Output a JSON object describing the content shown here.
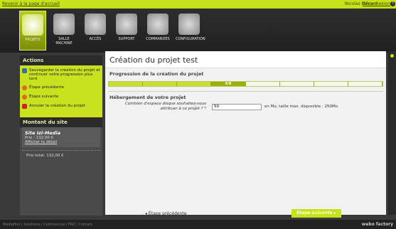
{
  "topbar": {
    "back_link": "Revenir à la page d'accueil",
    "user": "Nicolas Ménard",
    "logout": "Déconnexion",
    "help": "?"
  },
  "nav": [
    {
      "label": "PROJETS",
      "icon": "projects-icon"
    },
    {
      "label": "SALLE MACHINE",
      "icon": "server-icon"
    },
    {
      "label": "ACCÈS",
      "icon": "access-icon"
    },
    {
      "label": "SUPPORT",
      "icon": "support-icon"
    },
    {
      "label": "COMMANDES",
      "icon": "orders-icon"
    },
    {
      "label": "CONFIGURATION",
      "icon": "gear-icon"
    }
  ],
  "sidebar": {
    "actions_title": "Actions",
    "actions": [
      {
        "label": "Sauvegarder la création du projet et continuer votre progression plus tard",
        "icon": "save-icon"
      },
      {
        "label": "Étape précédente",
        "icon": "arrow-left-icon"
      },
      {
        "label": "Étape suivante",
        "icon": "arrow-right-icon"
      },
      {
        "label": "Annuler la création du projet",
        "icon": "warning-icon"
      }
    ],
    "amount_title": "Montant du site",
    "site_name": "Site Izi-Media",
    "site_price": "Prix : 132,00 €",
    "detail_link": "Afficher le détail",
    "total": "Prix total: 132,00 €"
  },
  "main": {
    "title": "Création du projet test",
    "progress_title": "Progression de la création du projet",
    "progress": {
      "current": 4,
      "total": 8,
      "label": "4/8"
    },
    "section_title": "Hébergement de votre projet",
    "disk_label": "Combien d'espace disque souhaitez-vous attribuer à ce projet ?",
    "disk_required": "*",
    "disk_value": "50",
    "disk_hint": "en Mo, taille max. disponible : 250Mo",
    "prev_label": "◂ Étape précédente",
    "next_label": "Étape suivante ▸"
  },
  "footer": {
    "links": "Mediafilm | Solutions | Commercial | FAQ | Contact",
    "brand": "webo factory"
  },
  "colors": {
    "accent": "#c6e21a",
    "dark": "#2a2a2a"
  }
}
